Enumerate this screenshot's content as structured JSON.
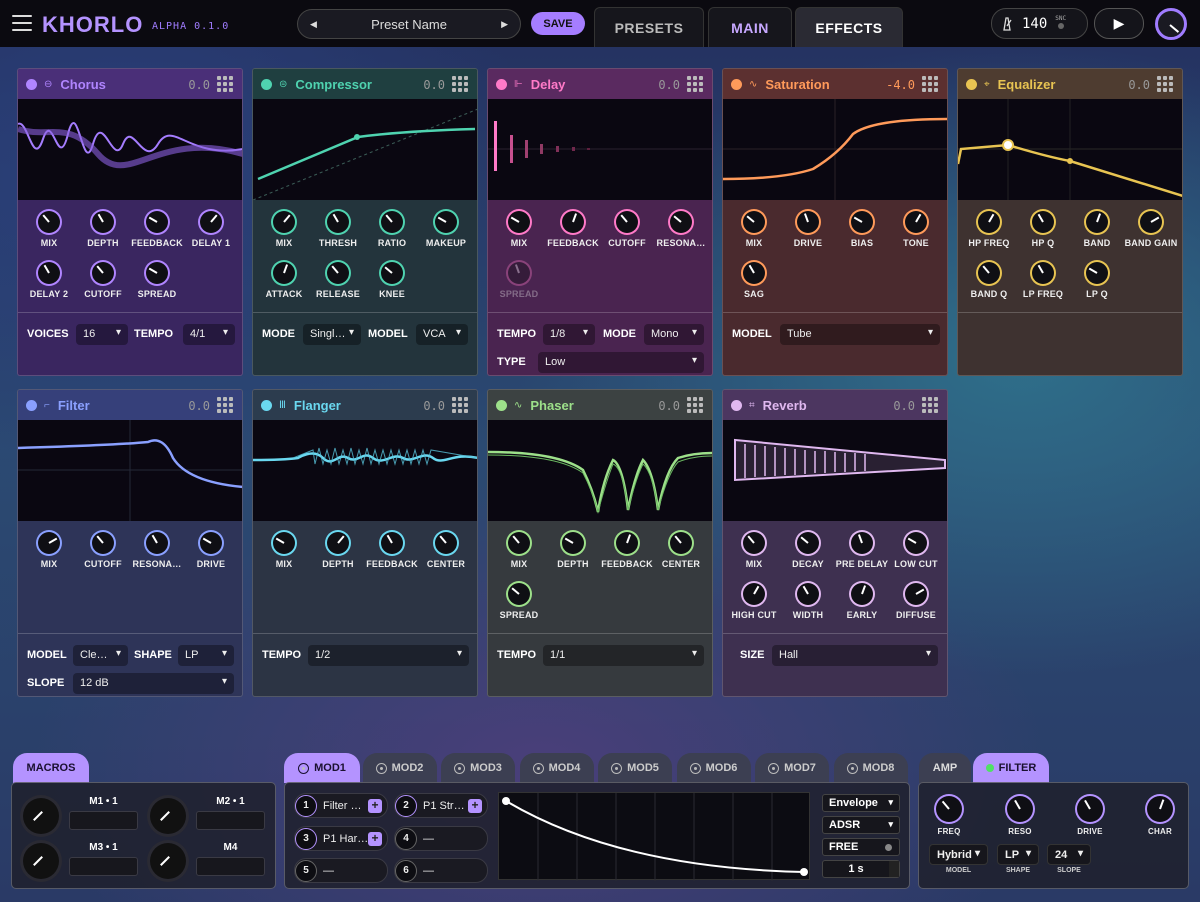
{
  "header": {
    "logo": "KHORLO",
    "version": "ALPHA 0.1.0",
    "preset_name": "Preset Name",
    "save_label": "SAVE",
    "tabs": [
      "PRESETS",
      "MAIN",
      "EFFECTS"
    ],
    "bpm": "140",
    "sync_label": "SNC"
  },
  "effects": [
    {
      "name": "Chorus",
      "value": "0.0",
      "color": "#b085ff",
      "knobs": [
        "MIX",
        "DEPTH",
        "FEEDBACK",
        "DELAY 1",
        "DELAY 2",
        "CUTOFF",
        "SPREAD"
      ],
      "controls": [
        {
          "label": "VOICES",
          "value": "16"
        },
        {
          "label": "TEMPO",
          "value": "4/1"
        }
      ]
    },
    {
      "name": "Compressor",
      "value": "0.0",
      "color": "#4fd3b0",
      "knobs": [
        "MIX",
        "THRESH",
        "RATIO",
        "MAKEUP",
        "ATTACK",
        "RELEASE",
        "KNEE"
      ],
      "controls": [
        {
          "label": "MODE",
          "value": "Singl…"
        },
        {
          "label": "MODEL",
          "value": "VCA"
        }
      ]
    },
    {
      "name": "Delay",
      "value": "0.0",
      "color": "#ff7ac8",
      "knobs": [
        "MIX",
        "FEEDBACK",
        "CUTOFF",
        "RESONA…",
        "SPREAD"
      ],
      "controls": [
        {
          "label": "TEMPO",
          "value": "1/8"
        },
        {
          "label": "MODE",
          "value": "Mono"
        },
        {
          "label": "TYPE",
          "value": "Low"
        }
      ]
    },
    {
      "name": "Saturation",
      "value": "-4.0",
      "color": "#ff9a5a",
      "knobs": [
        "MIX",
        "DRIVE",
        "BIAS",
        "TONE",
        "SAG"
      ],
      "controls": [
        {
          "label": "MODEL",
          "value": "Tube"
        }
      ]
    },
    {
      "name": "Equalizer",
      "value": "0.0",
      "color": "#e8c452",
      "knobs": [
        "HP FREQ",
        "HP Q",
        "BAND",
        "BAND GAIN",
        "BAND Q",
        "LP FREQ",
        "LP Q"
      ],
      "controls": []
    },
    {
      "name": "Filter",
      "value": "0.0",
      "color": "#8aa0ff",
      "knobs": [
        "MIX",
        "CUTOFF",
        "RESONA…",
        "DRIVE"
      ],
      "controls": [
        {
          "label": "MODEL",
          "value": "Cle…"
        },
        {
          "label": "SHAPE",
          "value": "LP"
        },
        {
          "label": "SLOPE",
          "value": "12 dB"
        }
      ]
    },
    {
      "name": "Flanger",
      "value": "0.0",
      "color": "#6ad8f0",
      "knobs": [
        "MIX",
        "DEPTH",
        "FEEDBACK",
        "CENTER"
      ],
      "controls": [
        {
          "label": "TEMPO",
          "value": "1/2"
        }
      ]
    },
    {
      "name": "Phaser",
      "value": "0.0",
      "color": "#9de08a",
      "knobs": [
        "MIX",
        "DEPTH",
        "FEEDBACK",
        "CENTER",
        "SPREAD"
      ],
      "controls": [
        {
          "label": "TEMPO",
          "value": "1/1"
        }
      ]
    },
    {
      "name": "Reverb",
      "value": "0.0",
      "color": "#e0b8f0",
      "knobs": [
        "MIX",
        "DECAY",
        "PRE DELAY",
        "LOW CUT",
        "HIGH CUT",
        "WIDTH",
        "EARLY",
        "DIFFUSE"
      ],
      "controls": [
        {
          "label": "SIZE",
          "value": "Hall"
        }
      ]
    }
  ],
  "macros": {
    "tab": "MACROS",
    "items": [
      "M1 • 1",
      "M2 • 1",
      "M3 • 1",
      "M4"
    ]
  },
  "mod": {
    "tabs": [
      "MOD1",
      "MOD2",
      "MOD3",
      "MOD4",
      "MOD5",
      "MOD6",
      "MOD7",
      "MOD8"
    ],
    "slots": [
      {
        "n": "1",
        "t": "Filter …"
      },
      {
        "n": "2",
        "t": "P1 Str…"
      },
      {
        "n": "3",
        "t": "P1 Har…"
      },
      {
        "n": "4",
        "t": "—"
      },
      {
        "n": "5",
        "t": "—"
      },
      {
        "n": "6",
        "t": "—"
      }
    ],
    "type": "Envelope",
    "shape": "ADSR",
    "mode": "FREE",
    "time": "1 s"
  },
  "amp": {
    "tabs": [
      "AMP",
      "FILTER"
    ],
    "knobs": [
      "FREQ",
      "RESO",
      "DRIVE",
      "CHAR"
    ],
    "selects": [
      {
        "label": "MODEL",
        "value": "Hybrid"
      },
      {
        "label": "SHAPE",
        "value": "LP"
      },
      {
        "label": "SLOPE",
        "value": "24"
      }
    ]
  }
}
